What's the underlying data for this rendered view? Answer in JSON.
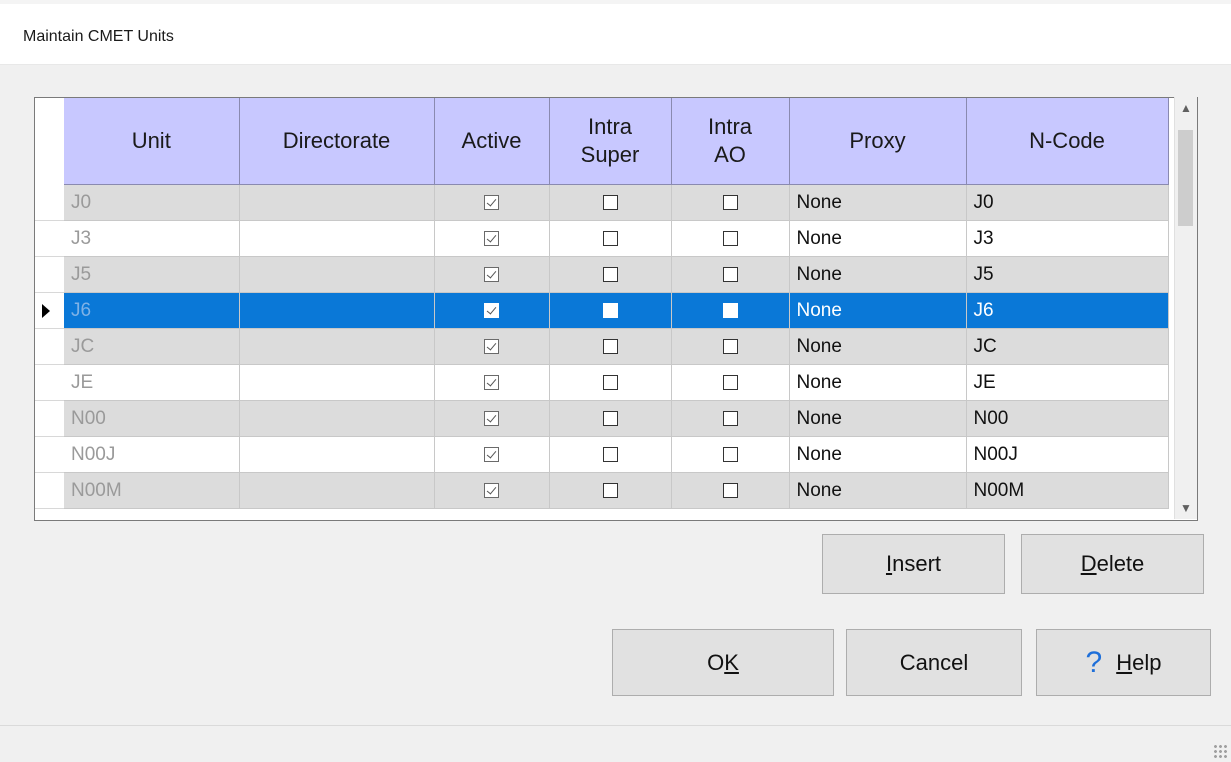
{
  "window": {
    "title": "Maintain CMET Units"
  },
  "grid": {
    "columns": [
      "Unit",
      "Directorate",
      "Active",
      "Intra\nSuper",
      "Intra\nAO",
      "Proxy",
      "N-Code"
    ],
    "rows": [
      {
        "unit": "J0",
        "directorate": "",
        "active": true,
        "intra_super": false,
        "intra_ao": false,
        "proxy": "None",
        "ncode": "J0"
      },
      {
        "unit": "J3",
        "directorate": "",
        "active": true,
        "intra_super": false,
        "intra_ao": false,
        "proxy": "None",
        "ncode": "J3"
      },
      {
        "unit": "J5",
        "directorate": "",
        "active": true,
        "intra_super": false,
        "intra_ao": false,
        "proxy": "None",
        "ncode": "J5"
      },
      {
        "unit": "J6",
        "directorate": "",
        "active": true,
        "intra_super": false,
        "intra_ao": false,
        "proxy": "None",
        "ncode": "J6",
        "selected": true
      },
      {
        "unit": "JC",
        "directorate": "",
        "active": true,
        "intra_super": false,
        "intra_ao": false,
        "proxy": "None",
        "ncode": "JC"
      },
      {
        "unit": "JE",
        "directorate": "",
        "active": true,
        "intra_super": false,
        "intra_ao": false,
        "proxy": "None",
        "ncode": "JE"
      },
      {
        "unit": "N00",
        "directorate": "",
        "active": true,
        "intra_super": false,
        "intra_ao": false,
        "proxy": "None",
        "ncode": "N00"
      },
      {
        "unit": "N00J",
        "directorate": "",
        "active": true,
        "intra_super": false,
        "intra_ao": false,
        "proxy": "None",
        "ncode": "N00J"
      },
      {
        "unit": "N00M",
        "directorate": "",
        "active": true,
        "intra_super": false,
        "intra_ao": false,
        "proxy": "None",
        "ncode": "N00M"
      }
    ]
  },
  "buttons": {
    "insert": {
      "mnemonic": "I",
      "rest": "nsert"
    },
    "delete": {
      "mnemonic": "D",
      "rest": "elete"
    },
    "ok": {
      "pre": "O",
      "mnemonic": "K"
    },
    "cancel": "Cancel",
    "help": {
      "mnemonic": "H",
      "rest": "elp"
    }
  },
  "icons": {
    "help": "question-mark-icon",
    "row_indicator": "row-pointer-icon",
    "scroll_up": "chevron-up-icon",
    "scroll_down": "chevron-down-icon",
    "resize_grip": "resize-grip-icon"
  },
  "colors": {
    "header_bg": "#c8c8ff",
    "selected_row": "#0a78d7",
    "alt_row": "#dcdcdc"
  }
}
